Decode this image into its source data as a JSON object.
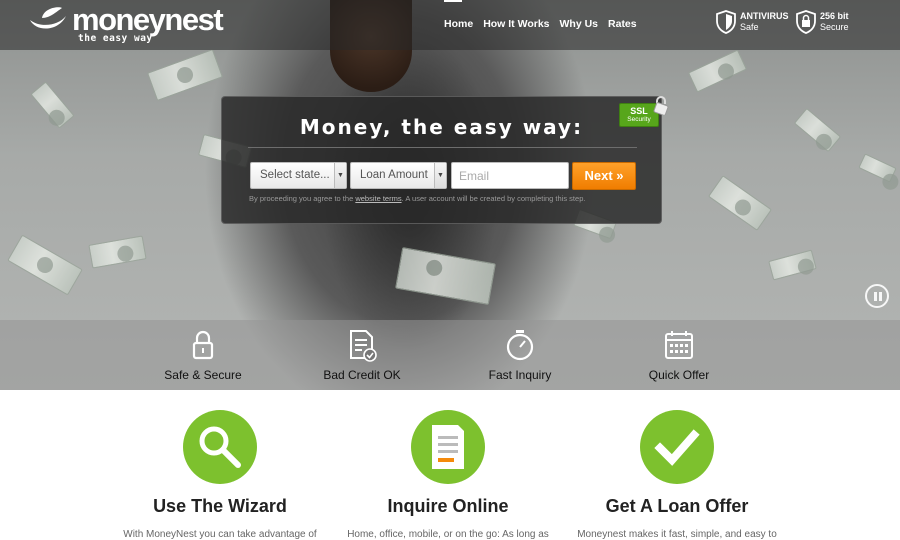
{
  "brand": {
    "name": "moneynest",
    "tagline": "the easy way"
  },
  "nav": {
    "items": [
      "Home",
      "How It Works",
      "Why Us",
      "Rates"
    ]
  },
  "badges": {
    "antivirus": {
      "title": "ANTIVIRUS",
      "sub": "Safe"
    },
    "encryption": {
      "title": "256 bit",
      "sub": "Secure"
    }
  },
  "form": {
    "title": "Money, the easy way:",
    "ssl_title": "SSL",
    "ssl_sub": "Security",
    "state_placeholder": "Select state...",
    "amount_placeholder": "Loan Amount",
    "email_placeholder": "Email",
    "next_label": "Next »",
    "disclaimer_pre": "By proceeding you agree to the ",
    "disclaimer_link": "website terms",
    "disclaimer_post": ". A user account will be created by completing this step."
  },
  "features": [
    "Safe & Secure",
    "Bad Credit OK",
    "Fast Inquiry",
    "Quick Offer"
  ],
  "steps": [
    {
      "title": "Use The Wizard",
      "text": "With MoneyNest you can take advantage of"
    },
    {
      "title": "Inquire Online",
      "text": "Home, office, mobile, or on the go: As long as"
    },
    {
      "title": "Get A Loan Offer",
      "text": "Moneynest makes it fast, simple, and easy to"
    }
  ],
  "colors": {
    "accent_green": "#7dc12e",
    "cta_orange": "#f58a0b",
    "ssl_green": "#57a61b"
  },
  "icons": {
    "features": [
      "lock-icon",
      "document-check-icon",
      "stopwatch-icon",
      "calendar-icon"
    ],
    "steps": [
      "magnifier-icon",
      "form-icon",
      "checkmark-icon"
    ]
  }
}
